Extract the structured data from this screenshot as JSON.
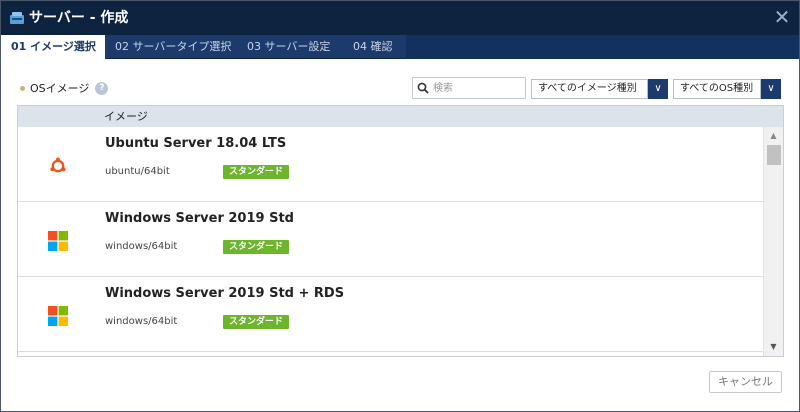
{
  "dialog": {
    "title": "サーバー - 作成",
    "close_label": "✕"
  },
  "tabs": [
    {
      "label": "01 イメージ選択",
      "active": true
    },
    {
      "label": "02 サーバータイプ選択",
      "active": false
    },
    {
      "label": "03 サーバー設定",
      "active": false
    },
    {
      "label": "04 確認",
      "active": false
    }
  ],
  "section": {
    "label": "OSイメージ",
    "help_label": "?"
  },
  "filters": {
    "search_placeholder": "検索",
    "image_type": "すべてのイメージ種別",
    "os_type": "すべてのOS種別",
    "arrow": "∨"
  },
  "table": {
    "column_header": "イメージ",
    "rows": [
      {
        "name": "Ubuntu Server 18.04 LTS",
        "path": "ubuntu/64bit",
        "badge": "スタンダード",
        "icon": "ubuntu-icon"
      },
      {
        "name": "Windows Server 2019 Std",
        "path": "windows/64bit",
        "badge": "スタンダード",
        "icon": "windows-icon"
      },
      {
        "name": "Windows Server 2019 Std + RDS",
        "path": "windows/64bit",
        "badge": "スタンダード",
        "icon": "windows-icon"
      }
    ]
  },
  "scrollbar": {
    "up_arrow": "▲",
    "down_arrow": "▼"
  },
  "footer": {
    "cancel_label": "キャンセル"
  },
  "colors": {
    "titlebar": "#0d2340",
    "tabbar": "#1c3a6c",
    "badge": "#6cb52d",
    "ubuntu": "#e95420"
  }
}
